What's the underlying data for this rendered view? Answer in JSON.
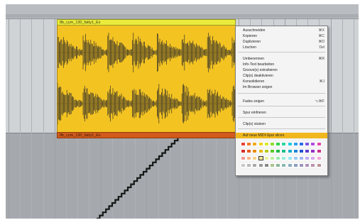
{
  "clip": {
    "name": "8b_cym_130_fatty1_Ex",
    "footer_name": "8b_cym_130_fatty1_Ex",
    "header_color": "#e9ec3c",
    "body_color": "#f3c321",
    "footer_color": "#d15a1c"
  },
  "context_menu": {
    "highlight_color": "#f0b81e",
    "items": [
      {
        "label": "Ausschneiden",
        "shortcut": "⌘X"
      },
      {
        "label": "Kopieren",
        "shortcut": "⌘C"
      },
      {
        "label": "Duplizieren",
        "shortcut": "⌘D"
      },
      {
        "label": "Löschen",
        "shortcut": "Del"
      },
      {
        "label": "Umbenennen",
        "shortcut": "⌘R"
      },
      {
        "label": "Info-Text bearbeiten",
        "shortcut": ""
      },
      {
        "label": "Groove(s) extrahieren",
        "shortcut": ""
      },
      {
        "label": "Clip(s) deaktivieren",
        "shortcut": ""
      },
      {
        "label": "Konsolidieren",
        "shortcut": "⌘J"
      },
      {
        "label": "Im Browser zeigen",
        "shortcut": ""
      },
      {
        "label": "Fades zeigen",
        "shortcut": "⌥⌘F"
      },
      {
        "label": "Spur einfrieren",
        "shortcut": ""
      },
      {
        "label": "Clip(s) stutzen",
        "shortcut": ""
      },
      {
        "label": "Auf neue MIDI-Spur slicen",
        "shortcut": ""
      }
    ],
    "highlighted_index": 13,
    "palette": [
      [
        "#e8443a",
        "#f07a2a",
        "#f4a81c",
        "#f2d21a",
        "#d6ea2a",
        "#8ede2e",
        "#34d24a",
        "#2ad6a0",
        "#24cbe0",
        "#2ea2ee",
        "#2f6cea",
        "#7a58e4",
        "#b24ee0",
        "#e04aa8"
      ],
      [
        "#d82e2e",
        "#e65a1e",
        "#e98e14",
        "#e6b812",
        "#b4cc1c",
        "#5cc82a",
        "#22b846",
        "#1ebc8a",
        "#18aec8",
        "#1f86d8",
        "#2452d0",
        "#5c3ec8",
        "#9432c2",
        "#c8328a"
      ],
      [
        "#f29a96",
        "#f6b88a",
        "#f8d28a",
        "#f6e69a",
        "#e6f29c",
        "#bff0a0",
        "#9ceab0",
        "#98eed8",
        "#98e6f2",
        "#9ccaf4",
        "#a2b4f0",
        "#bcacee",
        "#dca8ec",
        "#f2a8d4"
      ],
      [
        "#c9c9c9",
        "#b8b8b8",
        "#a8a8a8",
        "#989898",
        "#888888",
        "#a9c48e",
        "#8cb69c",
        "#8ab8b0",
        "#8aaebc",
        "#8c9cbc",
        "#9c94bc",
        "#b092bc",
        "#bc92ac",
        "#bc9496"
      ]
    ],
    "selected_swatch": [
      2,
      3
    ]
  }
}
